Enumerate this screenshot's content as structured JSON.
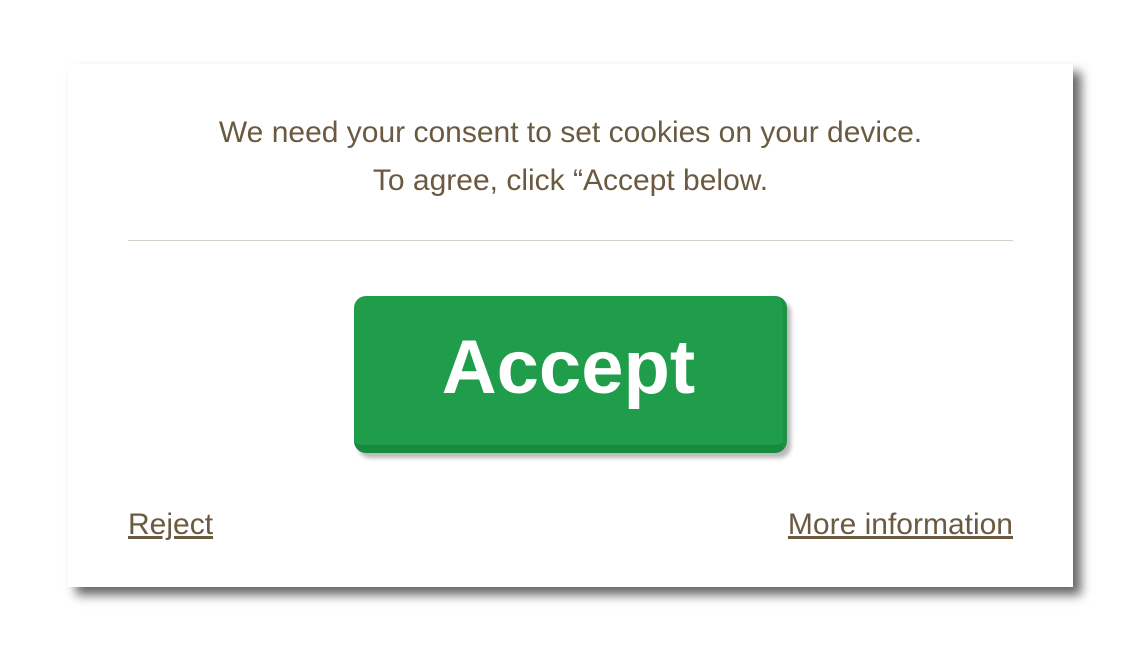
{
  "dialog": {
    "message_line1": "We need your consent to set cookies on your device.",
    "message_line2": "To agree, click “Accept below.",
    "accept_label": "Accept",
    "reject_label": "Reject",
    "more_info_label": "More information"
  },
  "colors": {
    "text": "#6b5a42",
    "accept_bg": "#1f9d4a",
    "accept_text": "#ffffff"
  }
}
